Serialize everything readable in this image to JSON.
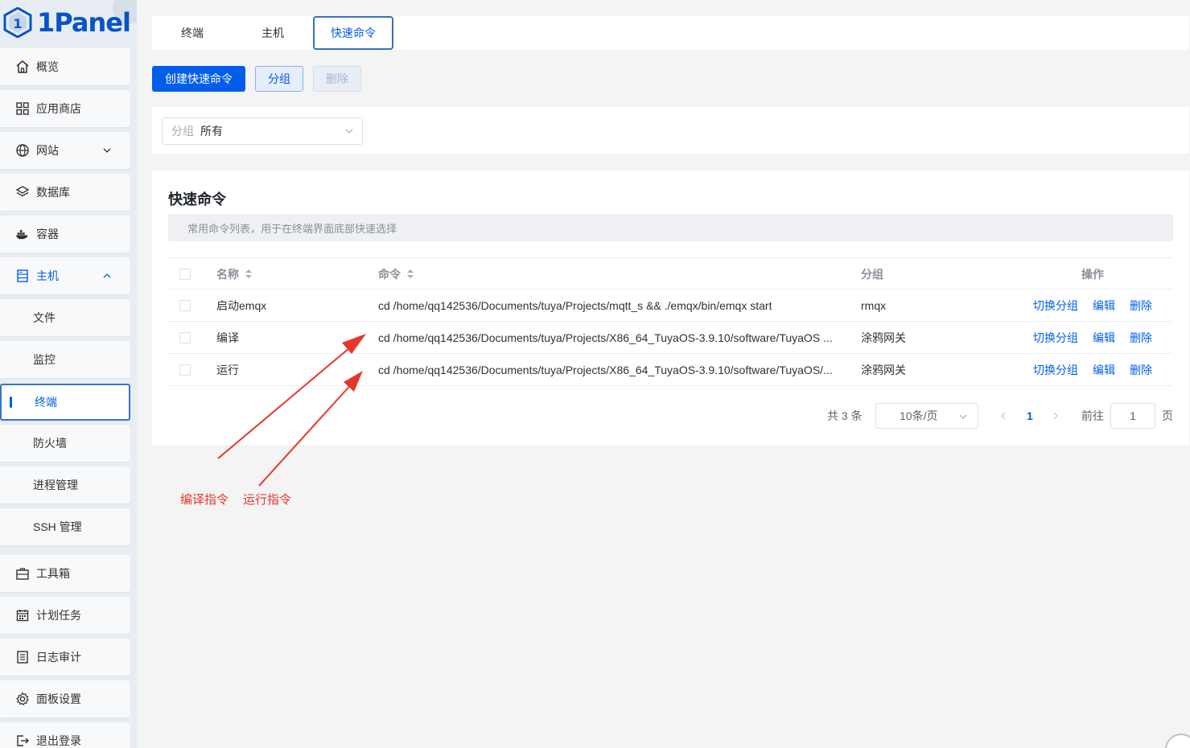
{
  "app": {
    "logo_text": "1Panel"
  },
  "sidebar": {
    "items": [
      {
        "label": "概览",
        "icon": "home-icon"
      },
      {
        "label": "应用商店",
        "icon": "grid-icon"
      },
      {
        "label": "网站",
        "icon": "globe-icon"
      },
      {
        "label": "数据库",
        "icon": "layers-icon"
      },
      {
        "label": "容器",
        "icon": "docker-icon"
      },
      {
        "label": "主机",
        "icon": "server-icon"
      },
      {
        "label": "文件"
      },
      {
        "label": "监控"
      },
      {
        "label": "终端"
      },
      {
        "label": "防火墙"
      },
      {
        "label": "进程管理"
      },
      {
        "label": "SSH 管理"
      },
      {
        "label": "工具箱",
        "icon": "toolbox-icon"
      },
      {
        "label": "计划任务",
        "icon": "calendar-icon"
      },
      {
        "label": "日志审计",
        "icon": "log-icon"
      },
      {
        "label": "面板设置",
        "icon": "gear-icon"
      },
      {
        "label": "退出登录",
        "icon": "logout-icon"
      }
    ]
  },
  "tabs": [
    {
      "label": "终端"
    },
    {
      "label": "主机"
    },
    {
      "label": "快速命令"
    }
  ],
  "toolbar": {
    "create_label": "创建快速命令",
    "group_label": "分组",
    "delete_label": "删除"
  },
  "filter": {
    "prefix": "分组",
    "value": "所有"
  },
  "card": {
    "title": "快速命令",
    "description": "常用命令列表，用于在终端界面底部快速选择"
  },
  "table": {
    "headers": {
      "name": "名称",
      "command": "命令",
      "group": "分组",
      "actions": "操作"
    },
    "rows": [
      {
        "name": "启动emqx",
        "command": "cd /home/qq142536/Documents/tuya/Projects/mqtt_s && ./emqx/bin/emqx start",
        "group": "rmqx"
      },
      {
        "name": "编译",
        "command": "cd /home/qq142536/Documents/tuya/Projects/X86_64_TuyaOS-3.9.10/software/TuyaOS ...",
        "group": "涂鸦网关"
      },
      {
        "name": "运行",
        "command": "cd /home/qq142536/Documents/tuya/Projects/X86_64_TuyaOS-3.9.10/software/TuyaOS/...",
        "group": "涂鸦网关"
      }
    ],
    "actions": {
      "switch_group": "切换分组",
      "edit": "编辑",
      "delete": "删除"
    }
  },
  "pagination": {
    "total": "共 3 条",
    "page_size": "10条/页",
    "current_page": "1",
    "goto_prefix": "前往",
    "goto_value": "1",
    "goto_suffix": "页"
  },
  "annotations": {
    "compile_label": "编译指令",
    "run_label": "运行指令",
    "color": "#e8362b"
  },
  "colors": {
    "primary": "#005eeb",
    "sidebar_bg": "#e8edf3"
  }
}
